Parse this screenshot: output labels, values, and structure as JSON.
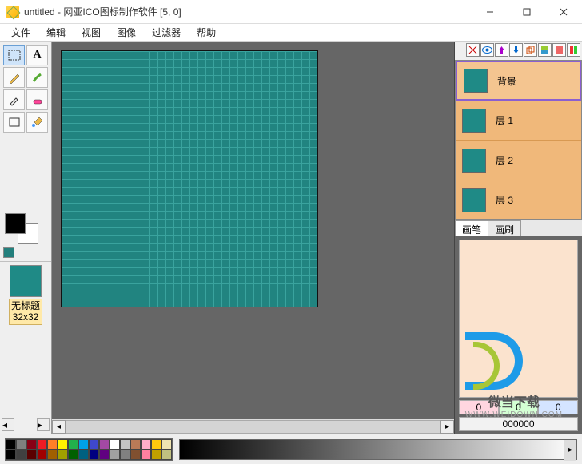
{
  "title": "untitled - 网亚ICO图标制作软件 [5, 0]",
  "menu": [
    "文件",
    "编辑",
    "视图",
    "图像",
    "过滤器",
    "帮助"
  ],
  "sidebar_thumb": {
    "label_line1": "无标题",
    "label_line2": "32x32"
  },
  "layers": [
    {
      "name": "背景",
      "selected": true
    },
    {
      "name": "层 1",
      "selected": false
    },
    {
      "name": "层 2",
      "selected": false
    },
    {
      "name": "层 3",
      "selected": false
    }
  ],
  "tabs": {
    "brush": "画笔",
    "brushset": "画刷"
  },
  "palette": [
    "#000000",
    "#7f7f7f",
    "#880015",
    "#ed1c24",
    "#ff7f27",
    "#fff200",
    "#22b14c",
    "#00a2e8",
    "#3f48cc",
    "#a349a4",
    "#ffffff",
    "#c3c3c3",
    "#b97a57",
    "#ffaec9",
    "#ffc90e",
    "#efe4b0",
    "#000000",
    "#404040",
    "#5a0000",
    "#a00000",
    "#a06000",
    "#a0a000",
    "#006000",
    "#006080",
    "#000080",
    "#600080",
    "#a0a0a0",
    "#808080",
    "#805030",
    "#ff80a0",
    "#c0a000",
    "#c0c080"
  ],
  "layer_icons": [
    "x-icon",
    "eye-icon",
    "arrow-up-icon",
    "arrow-down-icon",
    "duplicate-icon",
    "merge-icon",
    "color1-icon",
    "color2-icon"
  ],
  "status": {
    "r": "0",
    "g": "0",
    "b": "0",
    "hex": "000000"
  },
  "watermark": {
    "line1": "微当下载",
    "line2": "WWW.WEIDOWN.COM"
  }
}
